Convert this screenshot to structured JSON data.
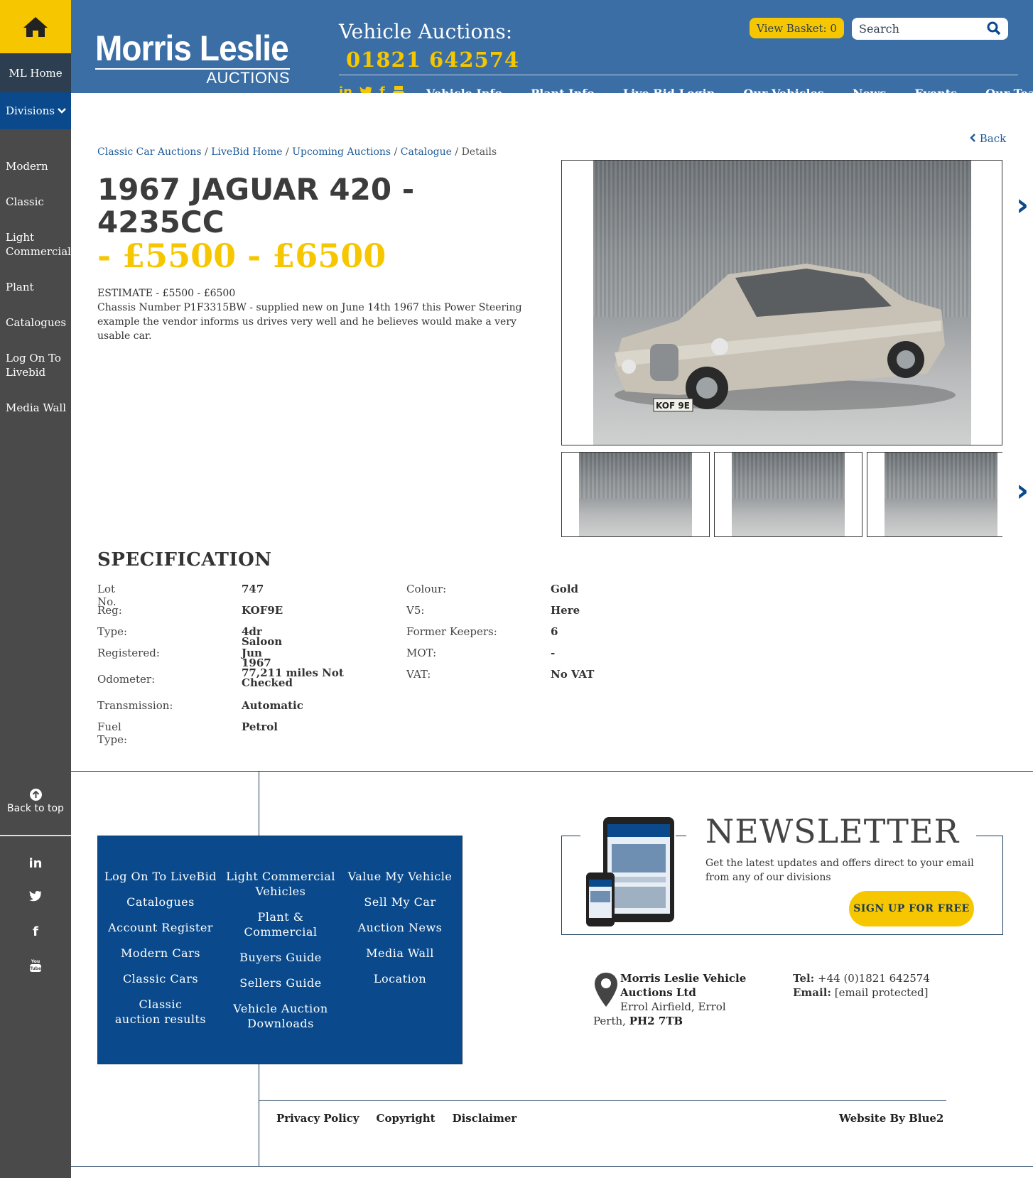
{
  "sidebar": {
    "ml_home": "ML Home",
    "divisions": "Divisions",
    "items": [
      "Modern",
      "Classic",
      "Light Commercial",
      "Plant",
      "Catalogues",
      "Log On To Livebid",
      "Media Wall"
    ],
    "back_to_top": "Back to top"
  },
  "header": {
    "logo_main": "Morris Leslie",
    "logo_sub": "AUCTIONS",
    "title": "Vehicle Auctions:",
    "phone": "01821 642574",
    "basket_label": "View Basket:",
    "basket_count": "0",
    "search_placeholder": "Search",
    "nav": [
      "Vehicle Info",
      "Plant Info",
      "Live Bid Login",
      "Our Vehicles",
      "News",
      "Events",
      "Our Team"
    ]
  },
  "breadcrumb": {
    "items": [
      "Classic Car Auctions",
      "LiveBid Home",
      "Upcoming Auctions",
      "Catalogue"
    ],
    "current": "Details",
    "sep": "/"
  },
  "back_label": "Back",
  "lot": {
    "title": "1967 JAGUAR 420 - 4235CC",
    "price": "- £5500 - £6500",
    "estimate": "ESTIMATE - £5500 - £6500",
    "description": "Chassis Number P1F3315BW - supplied new on June 14th 1967 this Power Steering example the vendor informs us drives very well and he believes would make a very usable car."
  },
  "spec": {
    "title": "SPECIFICATION",
    "left": [
      {
        "label": "Lot No.",
        "value": "747"
      },
      {
        "label": "Reg:",
        "value": "KOF9E"
      },
      {
        "label": "Type:",
        "value": "4dr Saloon"
      },
      {
        "label": "Registered:",
        "value": "Jun 1967"
      },
      {
        "label": "Odometer:",
        "value": "77,211 miles Not Checked"
      },
      {
        "label": "Transmission:",
        "value": "Automatic"
      },
      {
        "label": "Fuel Type:",
        "value": "Petrol"
      }
    ],
    "right": [
      {
        "label": "Colour:",
        "value": "Gold"
      },
      {
        "label": "V5:",
        "value": "Here"
      },
      {
        "label": "Former Keepers:",
        "value": "6"
      },
      {
        "label": "MOT:",
        "value": "-"
      },
      {
        "label": "VAT:",
        "value": "No VAT"
      }
    ]
  },
  "footer": {
    "col1": [
      "Log On To LiveBid",
      "Catalogues",
      "Account Register",
      "Modern Cars",
      "Classic Cars",
      "Classic auction results"
    ],
    "col2": [
      "Light Commercial Vehicles",
      "Plant & Commercial",
      "Buyers Guide",
      "Sellers Guide",
      "Vehicle Auction Downloads"
    ],
    "col3": [
      "Value My Vehicle",
      "Sell My Car",
      "Auction News",
      "Media Wall",
      "Location"
    ],
    "newsletter_title": "NEWSLETTER",
    "newsletter_text": "Get the latest updates and offers direct to your email from any of our divisions",
    "signup": "SIGN UP FOR FREE",
    "company_l1": "Morris Leslie Vehicle",
    "company_l2": "Auctions Ltd",
    "addr_l1": "Errol Airfield, Errol",
    "addr_city": "Perth,",
    "postcode": "PH2 7TB",
    "tel_label": "Tel:",
    "tel": "+44 (0)1821 642574",
    "email_label": "Email:",
    "email": "[email protected]",
    "legal": [
      "Privacy Policy",
      "Copyright",
      "Disclaimer"
    ],
    "by": "Website By Blue2"
  },
  "colors": {
    "brand_blue": "#3a6ea5",
    "navy": "#0a4a8c",
    "yellow": "#f6c700",
    "sidebar": "#4a4a4a"
  }
}
